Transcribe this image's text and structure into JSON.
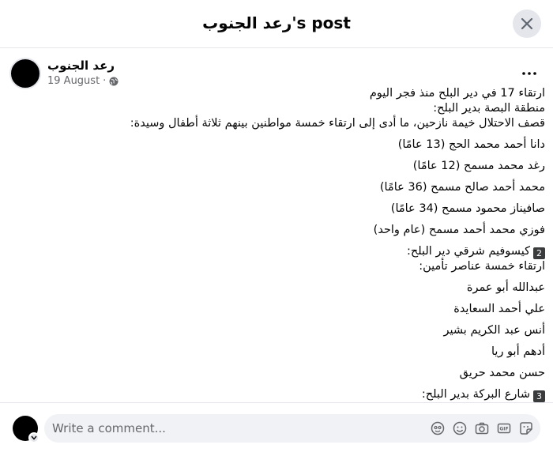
{
  "header": {
    "title": "رعد الجنوب's post"
  },
  "post": {
    "author": "رعد الجنوب",
    "date": "19 August",
    "separator": "·",
    "lines": [
      {
        "text": "ارتقاء 17 في دير البلح منذ فجر اليوم"
      },
      {
        "text": "منطقة البصة بدير البلح:"
      },
      {
        "text": "قصف الاحتلال خيمة نازحين، ما أدى إلى ارتقاء خمسة مواطنين بينهم ثلاثة أطفال وسيدة:",
        "gap_after": true
      },
      {
        "text": "دانا أحمد محمد الحج (13 عامًا)",
        "gap_after": true
      },
      {
        "text": "رغد محمد مسمح (12 عامًا)",
        "gap_after": true
      },
      {
        "text": "محمد أحمد صالح مسمح (36 عامًا)",
        "gap_after": true
      },
      {
        "text": "صافيناز محمود مسمح (34 عامًا)",
        "gap_after": true
      },
      {
        "text": "فوزي محمد أحمد مسمح (عام واحد)",
        "gap_after": true
      },
      {
        "text": "كيسوفيم شرقي دير البلح:",
        "badge": "2"
      },
      {
        "text": "ارتقاء خمسة عناصر تأمين:",
        "gap_after": true
      },
      {
        "text": "عبدالله أبو عمرة",
        "gap_after": true
      },
      {
        "text": "علي أحمد السعايدة",
        "gap_after": true
      },
      {
        "text": "أنس عبد الكريم بشير",
        "gap_after": true
      },
      {
        "text": "أدهم أبو ريا",
        "gap_after": true
      },
      {
        "text": "حسن محمد حريق",
        "gap_after": true
      },
      {
        "text": "شارع البركة بدير البلح:",
        "badge": "3"
      }
    ]
  },
  "comment": {
    "placeholder": "Write a comment...",
    "icons": [
      "avatar-sticker-icon",
      "emoji-icon",
      "camera-icon",
      "gif-icon",
      "sticker-icon"
    ]
  }
}
